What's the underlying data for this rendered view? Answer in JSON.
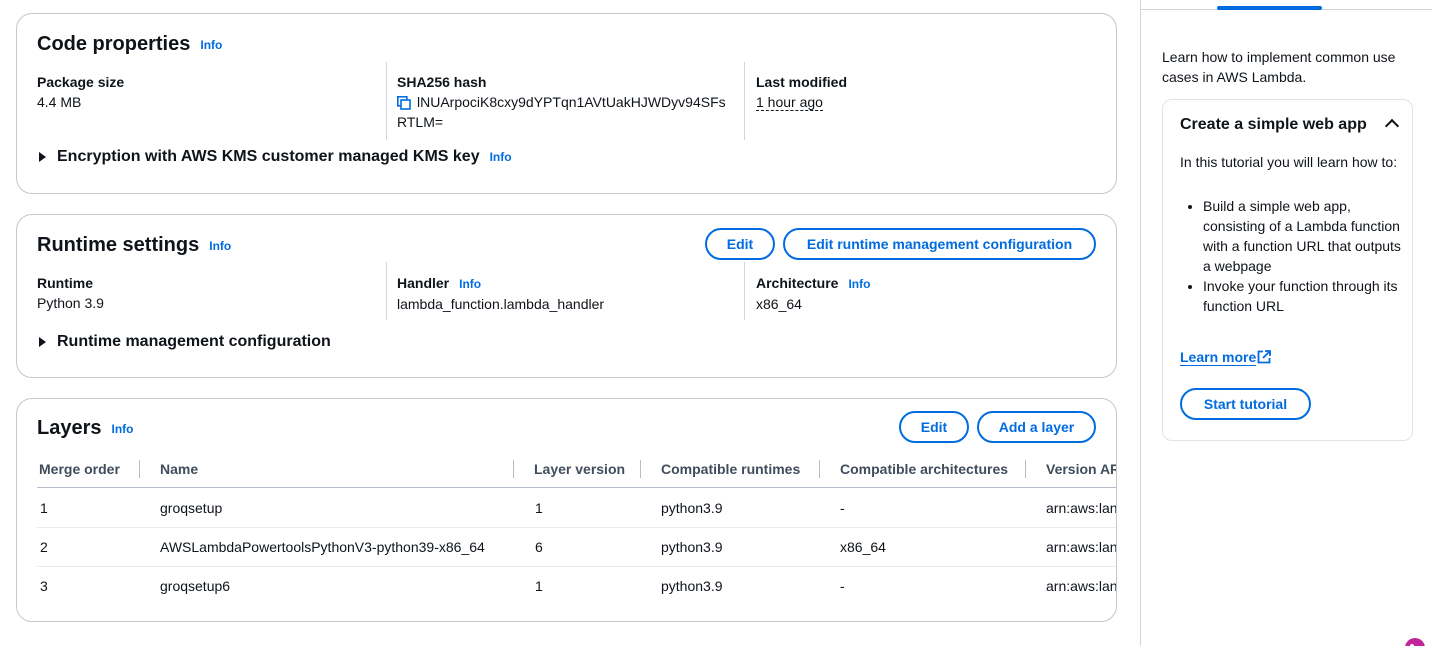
{
  "code_properties": {
    "title": "Code properties",
    "info": "Info",
    "package_size_label": "Package size",
    "package_size_value": "4.4 MB",
    "sha_label": "SHA256 hash",
    "sha_value_line1": "lNUArpociK8cxy9dYPTqn1AVtUakHJWDyv94SFs",
    "sha_value_line2": "RTLM=",
    "last_modified_label": "Last modified",
    "last_modified_value": "1 hour ago",
    "encryption_label": "Encryption with AWS KMS customer managed KMS key",
    "encryption_info": "Info"
  },
  "runtime_settings": {
    "title": "Runtime settings",
    "info": "Info",
    "edit_button": "Edit",
    "edit_runtime_mgmt_button": "Edit runtime management configuration",
    "runtime_label": "Runtime",
    "runtime_value": "Python 3.9",
    "handler_label": "Handler",
    "handler_info": "Info",
    "handler_value": "lambda_function.lambda_handler",
    "architecture_label": "Architecture",
    "architecture_info": "Info",
    "architecture_value": "x86_64",
    "runtime_mgmt_label": "Runtime management configuration"
  },
  "layers": {
    "title": "Layers",
    "info": "Info",
    "edit_button": "Edit",
    "add_button": "Add a layer",
    "columns": [
      "Merge order",
      "Name",
      "Layer version",
      "Compatible runtimes",
      "Compatible architectures",
      "Version AR"
    ],
    "rows": [
      {
        "merge_order": "1",
        "name": "groqsetup",
        "version": "1",
        "runtimes": "python3.9",
        "architectures": "-",
        "arn": "arn:aws:lan"
      },
      {
        "merge_order": "2",
        "name": "AWSLambdaPowertoolsPythonV3-python39-x86_64",
        "version": "6",
        "runtimes": "python3.9",
        "architectures": "x86_64",
        "arn": "arn:aws:lan"
      },
      {
        "merge_order": "3",
        "name": "groqsetup6",
        "version": "1",
        "runtimes": "python3.9",
        "architectures": "-",
        "arn": "arn:aws:lan"
      }
    ]
  },
  "sidebar": {
    "intro": "Learn how to implement common use cases in AWS Lambda.",
    "tutorial": {
      "title": "Create a simple web app",
      "body": "In this tutorial you will learn how to:",
      "bullets": [
        "Build a simple web app, consisting of a Lambda function with a function URL that outputs a webpage",
        "Invoke your function through its function URL"
      ],
      "learn_more": "Learn more",
      "start_button": "Start tutorial"
    }
  },
  "colors": {
    "accent": "#006ce0",
    "text": "#0f141a",
    "border": "#c6c6cd"
  }
}
